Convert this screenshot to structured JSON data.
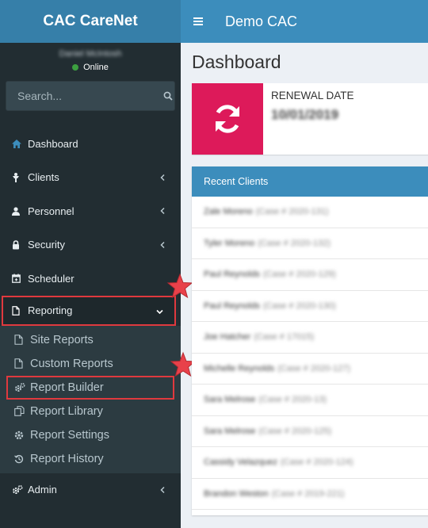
{
  "app": {
    "brand": "CAC CareNet",
    "org_name": "Demo CAC"
  },
  "user": {
    "name": "Daniel McIntosh",
    "status": "Online"
  },
  "search": {
    "placeholder": "Search..."
  },
  "sidebar": {
    "items": [
      {
        "label": "Dashboard",
        "icon": "dashboard-icon"
      },
      {
        "label": "Clients",
        "icon": "clients-icon"
      },
      {
        "label": "Personnel",
        "icon": "user-icon"
      },
      {
        "label": "Security",
        "icon": "lock-icon"
      },
      {
        "label": "Scheduler",
        "icon": "calendar-icon"
      },
      {
        "label": "Reporting",
        "icon": "file-icon"
      },
      {
        "label": "Admin",
        "icon": "cogs-icon"
      }
    ],
    "reporting_submenu": [
      {
        "label": "Site Reports",
        "icon": "file-icon"
      },
      {
        "label": "Custom Reports",
        "icon": "file-icon"
      },
      {
        "label": "Report Builder",
        "icon": "cogs-icon"
      },
      {
        "label": "Report Library",
        "icon": "copy-icon"
      },
      {
        "label": "Report Settings",
        "icon": "gear-icon"
      },
      {
        "label": "Report History",
        "icon": "history-icon"
      }
    ]
  },
  "main": {
    "title": "Dashboard",
    "renewal": {
      "label": "RENEWAL DATE",
      "value": "10/01/2019",
      "icon": "refresh-icon"
    },
    "recent_clients": {
      "title": "Recent Clients",
      "rows": [
        {
          "name": "Zale Moreno",
          "case": "(Case # 2020-131)"
        },
        {
          "name": "Tyler Moreno",
          "case": "(Case # 2020-132)"
        },
        {
          "name": "Paul Reynolds",
          "case": "(Case # 2020-129)"
        },
        {
          "name": "Paul Reynolds",
          "case": "(Case # 2020-130)"
        },
        {
          "name": "Joe Hatcher",
          "case": "(Case # 17015)"
        },
        {
          "name": "Michelle Reynolds",
          "case": "(Case # 2020-127)"
        },
        {
          "name": "Sara Melrose",
          "case": "(Case # 2020-13)"
        },
        {
          "name": "Sara Melrose",
          "case": "(Case # 2020-125)"
        },
        {
          "name": "Cassidy Velazquez",
          "case": "(Case # 2020-124)"
        },
        {
          "name": "Brandon Weston",
          "case": "(Case # 2019-221)"
        }
      ]
    }
  },
  "colors": {
    "brand_dark": "#367fa9",
    "brand": "#3c8dbc",
    "sidebar": "#222d32",
    "accent_pink": "#dd1a5a",
    "highlight_red": "#e0393e"
  }
}
